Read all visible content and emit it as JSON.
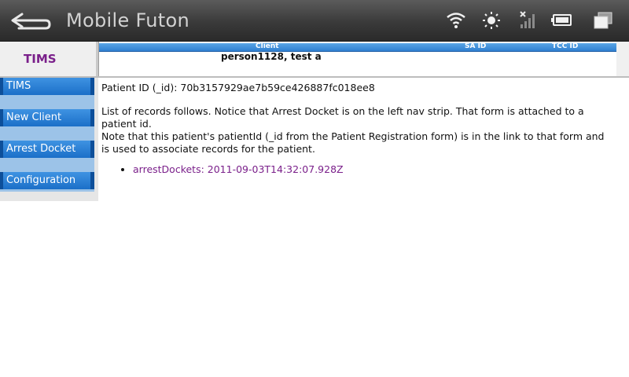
{
  "topbar": {
    "title": "Mobile Futon",
    "icons": [
      "back-arrow-icon",
      "wifi-icon",
      "brightness-icon",
      "signal-icon",
      "battery-icon",
      "windows-icon"
    ]
  },
  "header": {
    "brand": "TIMS",
    "columns": {
      "client": "Client",
      "sa_id": "SA ID",
      "tcc_id": "TCC ID"
    },
    "client_value": "person1128, test a"
  },
  "nav": {
    "items": [
      {
        "label": "TIMS"
      },
      {
        "label": "New Client"
      },
      {
        "label": "Arrest Docket"
      },
      {
        "label": "Configuration"
      }
    ]
  },
  "main": {
    "patient_id": "Patient ID (_id): 70b3157929ae7b59ce426887fc018ee8",
    "para1": "List of records follows. Notice that Arrest Docket is on the left nav strip. That form is attached to a patient id.",
    "para2": "Note that this patient's patientId (_id from the Patient Registration form) is in the link to that form and is used to associate records for the patient.",
    "records": [
      {
        "label": "arrestDockets: 2011-09-03T14:32:07.928Z"
      }
    ]
  },
  "colors": {
    "topbar": "#3a3a3a",
    "brand": "#7a1f8a",
    "nav_item": "#2a80d6",
    "nav_band": "#9cc3e8",
    "link": "#7a1f8a"
  }
}
